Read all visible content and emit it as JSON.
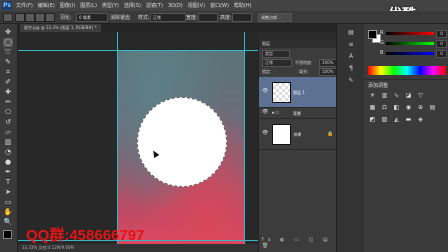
{
  "menubar": {
    "app_icon": "Ps",
    "items": [
      "文件(F)",
      "编辑(E)",
      "图像(I)",
      "图层(L)",
      "类型(Y)",
      "选择(S)",
      "滤镜(T)",
      "3D(D)",
      "视图(V)",
      "窗口(W)",
      "帮助(H)"
    ]
  },
  "options": {
    "feather_label": "羽化:",
    "feather_value": "0 像素",
    "antialias_label": "消除锯齿",
    "style_label": "样式:",
    "style_value": "正常",
    "width_label": "宽度:",
    "height_label": "高度:",
    "refine_edge": "调整边缘..."
  },
  "document": {
    "tab_label": "星空.jpg @ 33.3% (图层 1, RGB/8#) *",
    "status_text": "33.33%  文档:4.12M/9.66M"
  },
  "watermark": "QQ群:458666797",
  "logo": "优酷",
  "layers_panel": {
    "title": "图层",
    "kind_label": "类型",
    "blend_mode": "正常",
    "opacity_label": "不透明度:",
    "opacity_value": "100%",
    "lock_label": "锁定:",
    "fill_label": "填充:",
    "fill_value": "100%",
    "layers": [
      {
        "name": "图层 1",
        "selected": true
      },
      {
        "name": "背景",
        "selected": false,
        "group": true
      },
      {
        "name": "背景",
        "selected": false,
        "locked": true
      }
    ],
    "bottom_icons": "fx ◐ ▭ ◫ ▤ 🗑"
  },
  "color_panel": {
    "r_label": "R",
    "g_label": "G",
    "b_label": "B",
    "r_value": "0",
    "g_value": "0",
    "b_value": "0",
    "foreground": "#000000",
    "background": "#ffffff"
  },
  "adjustments_panel": {
    "title": "添加调整"
  },
  "colors": {
    "guide": "#36b6c8",
    "selected_layer": "#5d7293",
    "watermark": "#e41414"
  }
}
